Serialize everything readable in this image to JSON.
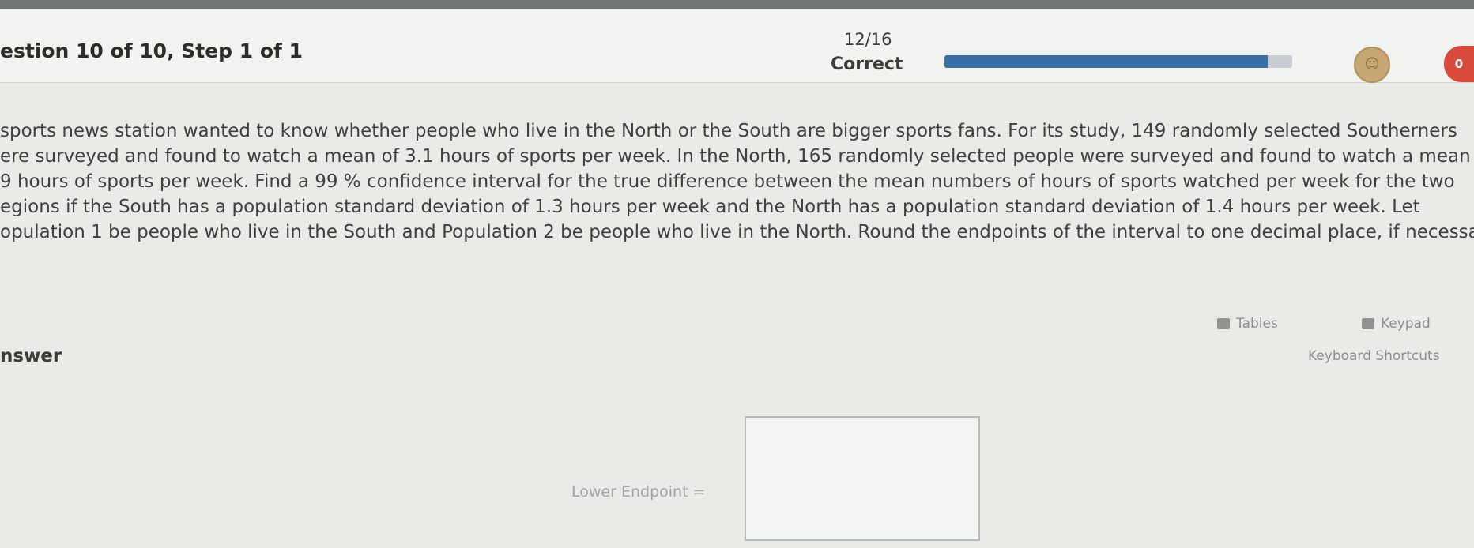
{
  "header": {
    "question_title": "estion 10 of 10, Step 1 of 1",
    "progress_count": "12/16",
    "progress_status": "Correct",
    "progress_fraction": 0.93,
    "heart_count": "0"
  },
  "question": {
    "lines": [
      "sports news station wanted to know whether people who live in the North or the South are bigger sports fans. For its study, 149 randomly selected Southerners",
      "ere surveyed and found to watch a mean of 3.1 hours of sports per week. In the North, 165 randomly selected people were surveyed and found to watch a mean of",
      "9 hours of sports per week. Find a 99 %  confidence interval for the true difference between the mean numbers of hours of sports watched per week for the two",
      "egions if the South has a population standard deviation of 1.3 hours per week and the North has a population standard deviation of 1.4 hours per week. Let",
      "opulation 1 be people who live in the South and Population 2 be people who live in the North. Round the endpoints of the interval to one decimal place, if necessary."
    ]
  },
  "tools": {
    "tables_label": "Tables",
    "keypad_label": "Keypad",
    "shortcuts_label": "Keyboard Shortcuts"
  },
  "answer": {
    "section_label": "nswer",
    "lower_endpoint_label": "Lower Endpoint =",
    "lower_endpoint_value": ""
  },
  "colors": {
    "progress_fill": "#3b6fa6",
    "heart": "#d84a3c",
    "background": "#e9ebe6"
  },
  "icons": [
    "table-icon",
    "keypad-icon",
    "avatar-icon",
    "heart-icon"
  ]
}
